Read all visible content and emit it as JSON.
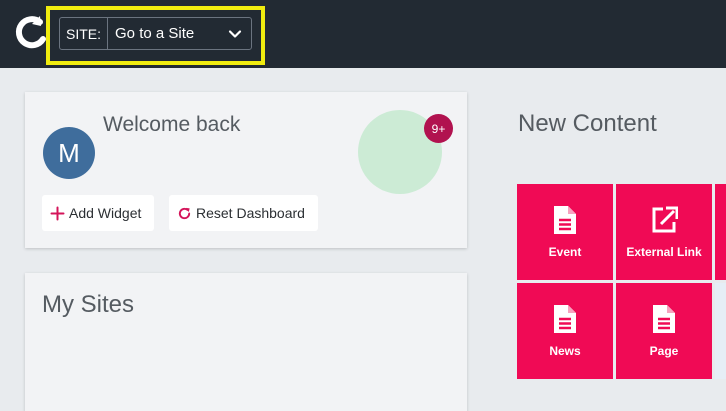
{
  "header": {
    "site_label": "SITE:",
    "site_value": "Go to a Site"
  },
  "welcome": {
    "avatar_initial": "M",
    "greeting": "Welcome back",
    "notification_count": "9+",
    "add_widget_label": "Add Widget",
    "reset_dashboard_label": "Reset Dashboard"
  },
  "my_sites": {
    "title": "My Sites"
  },
  "new_content": {
    "title": "New Content",
    "tiles": [
      {
        "label": "Event",
        "icon": "document-icon"
      },
      {
        "label": "External Link",
        "icon": "external-link-icon"
      },
      {
        "label": "News",
        "icon": "document-icon"
      },
      {
        "label": "Page",
        "icon": "document-icon"
      }
    ]
  },
  "colors": {
    "topbar": "#222a33",
    "highlight": "#f0ec0f",
    "tile": "#f00a55",
    "badge": "#b1124f",
    "avatar": "#3f6d9c",
    "stat_circle": "#ccebd5"
  }
}
